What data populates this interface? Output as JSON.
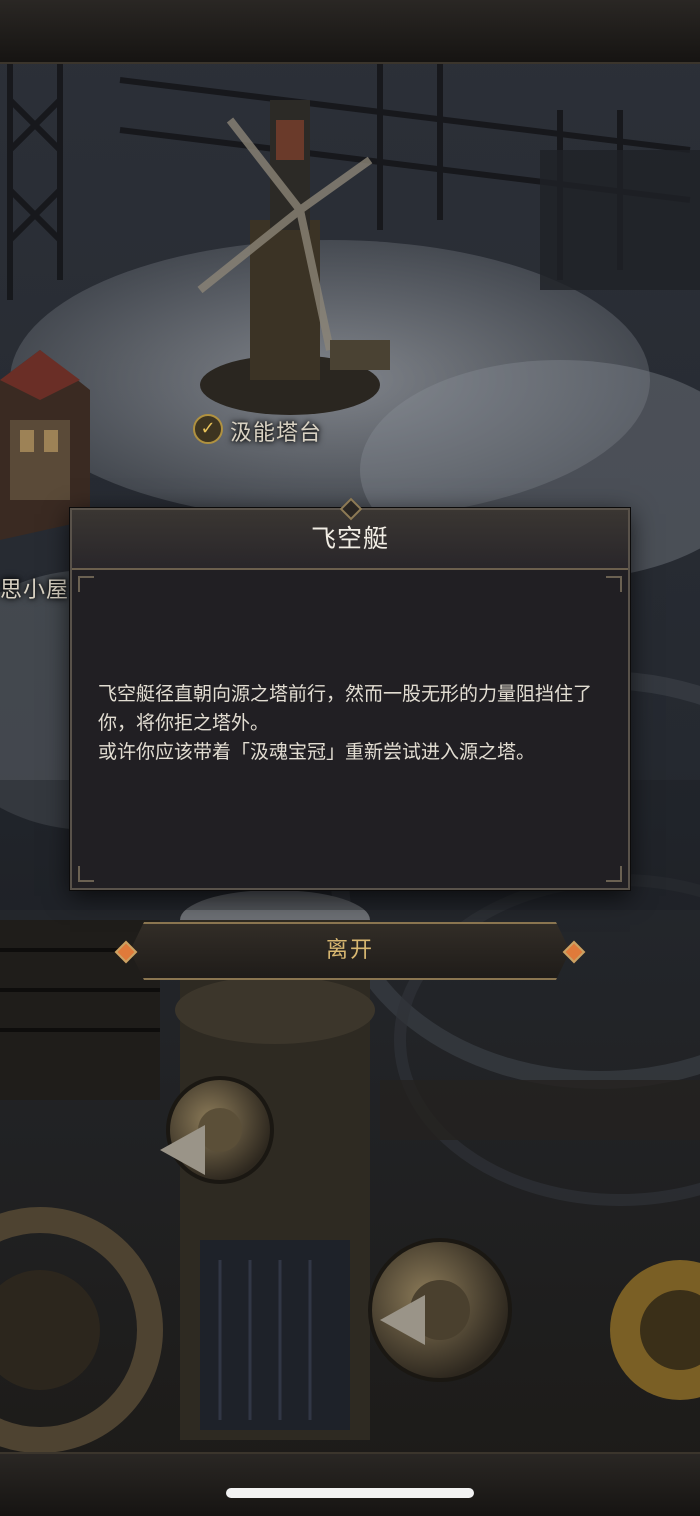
{
  "map": {
    "labels": {
      "energy_tower": "汲能塔台",
      "house": "思小屋"
    }
  },
  "dialog": {
    "title": "飞空艇",
    "body_line1": "飞空艇径直朝向源之塔前行，然而一股无形的力量阻挡住了你，将你拒之塔外。",
    "body_line2": "或许你应该带着「汲魂宝冠」重新尝试进入源之塔。"
  },
  "actions": {
    "leave_label": "离开"
  },
  "colors": {
    "accent_gold": "#d9b871",
    "gem_orange": "#e07a3a",
    "dialog_bg": "#211f23"
  },
  "icons": {
    "check": "check-badge-icon"
  }
}
